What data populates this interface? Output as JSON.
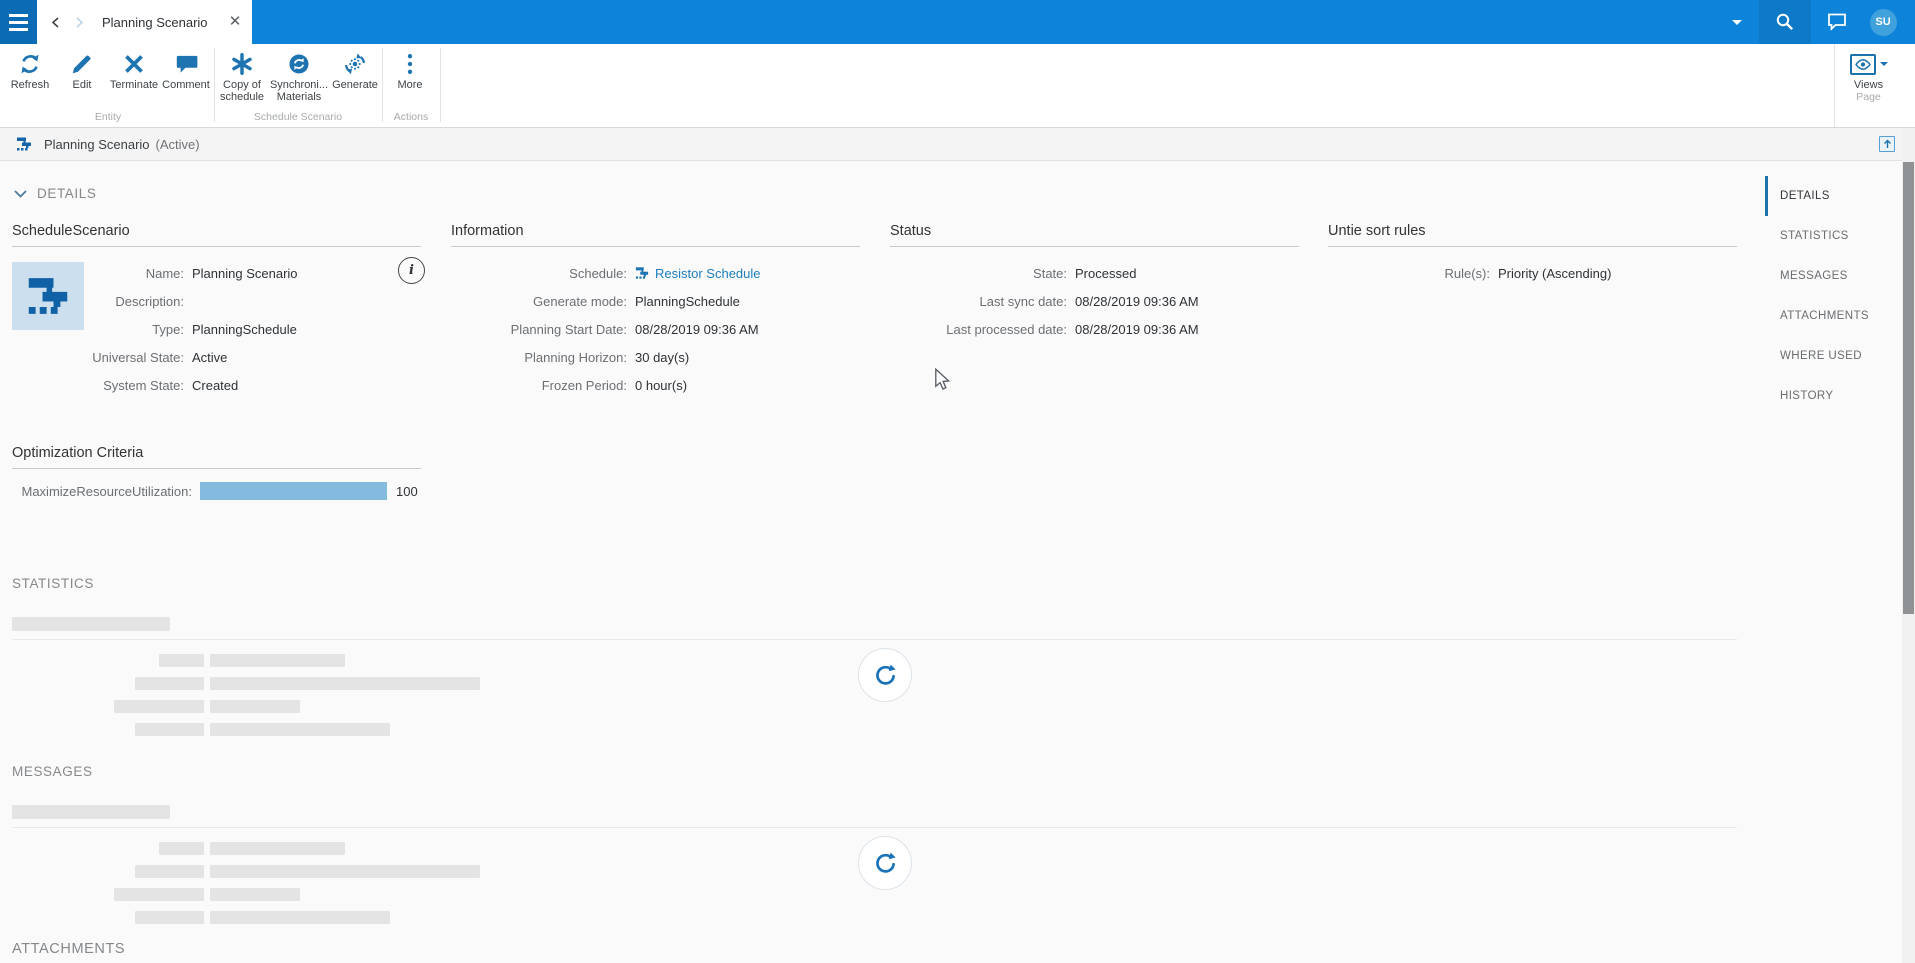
{
  "topbar": {
    "tab_title": "Planning Scenario",
    "avatar_initials": "SU"
  },
  "toolbar": {
    "groups": [
      {
        "label": "Entity",
        "buttons": [
          {
            "label": "Refresh",
            "icon": "refresh-icon"
          },
          {
            "label": "Edit",
            "icon": "edit-icon"
          },
          {
            "label": "Terminate",
            "icon": "terminate-icon"
          },
          {
            "label": "Comment",
            "icon": "comment-icon"
          }
        ]
      },
      {
        "label": "Schedule Scenario",
        "buttons": [
          {
            "label": "Copy of schedule",
            "icon": "copy-schedule-icon"
          },
          {
            "label": "Synchroni... Materials",
            "icon": "synchronize-icon"
          },
          {
            "label": "Generate",
            "icon": "generate-icon"
          }
        ]
      },
      {
        "label": "Actions",
        "buttons": [
          {
            "label": "More",
            "icon": "more-icon"
          }
        ]
      }
    ],
    "views_label": "Views",
    "page_group_label": "Page"
  },
  "breadcrumb": {
    "title": "Planning Scenario",
    "state": "(Active)"
  },
  "details": {
    "section_title": "DETAILS",
    "schedule_scenario": {
      "title": "ScheduleScenario",
      "fields": [
        {
          "label": "Name:",
          "value": "Planning Scenario"
        },
        {
          "label": "Description:",
          "value": ""
        },
        {
          "label": "Type:",
          "value": "PlanningSchedule"
        },
        {
          "label": "Universal State:",
          "value": "Active"
        },
        {
          "label": "System State:",
          "value": "Created"
        }
      ],
      "info_button": "i"
    },
    "information": {
      "title": "Information",
      "fields": [
        {
          "label": "Schedule:",
          "value": "Resistor Schedule",
          "link": true,
          "icon": "schedule-icon"
        },
        {
          "label": "Generate mode:",
          "value": "PlanningSchedule"
        },
        {
          "label": "Planning Start Date:",
          "value": "08/28/2019 09:36 AM"
        },
        {
          "label": "Planning Horizon:",
          "value": "30 day(s)"
        },
        {
          "label": "Frozen Period:",
          "value": "0 hour(s)"
        }
      ]
    },
    "status": {
      "title": "Status",
      "fields": [
        {
          "label": "State:",
          "value": "Processed"
        },
        {
          "label": "Last sync date:",
          "value": "08/28/2019 09:36 AM"
        },
        {
          "label": "Last processed date:",
          "value": "08/28/2019 09:36 AM"
        }
      ]
    },
    "untie_sort_rules": {
      "title": "Untie sort rules",
      "fields": [
        {
          "label": "Rule(s):",
          "value": "Priority (Ascending)"
        }
      ]
    },
    "optimization": {
      "title": "Optimization Criteria",
      "rows": [
        {
          "label": "MaximizeResourceUtilization:",
          "value": 100,
          "max": 100
        }
      ]
    }
  },
  "statistics": {
    "title": "STATISTICS",
    "loading": true
  },
  "messages": {
    "title": "MESSAGES",
    "loading": true
  },
  "attachments": {
    "title": "ATTACHMENTS"
  },
  "sidebar": {
    "active": "DETAILS",
    "items": [
      "DETAILS",
      "STATISTICS",
      "MESSAGES",
      "ATTACHMENTS",
      "WHERE USED",
      "HISTORY"
    ]
  },
  "colors": {
    "topbar_blue": "#0d83d9",
    "icon_blue": "#1e73b1",
    "link_blue": "#1d7dbd",
    "progress_fill": "#85badf",
    "avatar_bg": "#41a1dc"
  }
}
